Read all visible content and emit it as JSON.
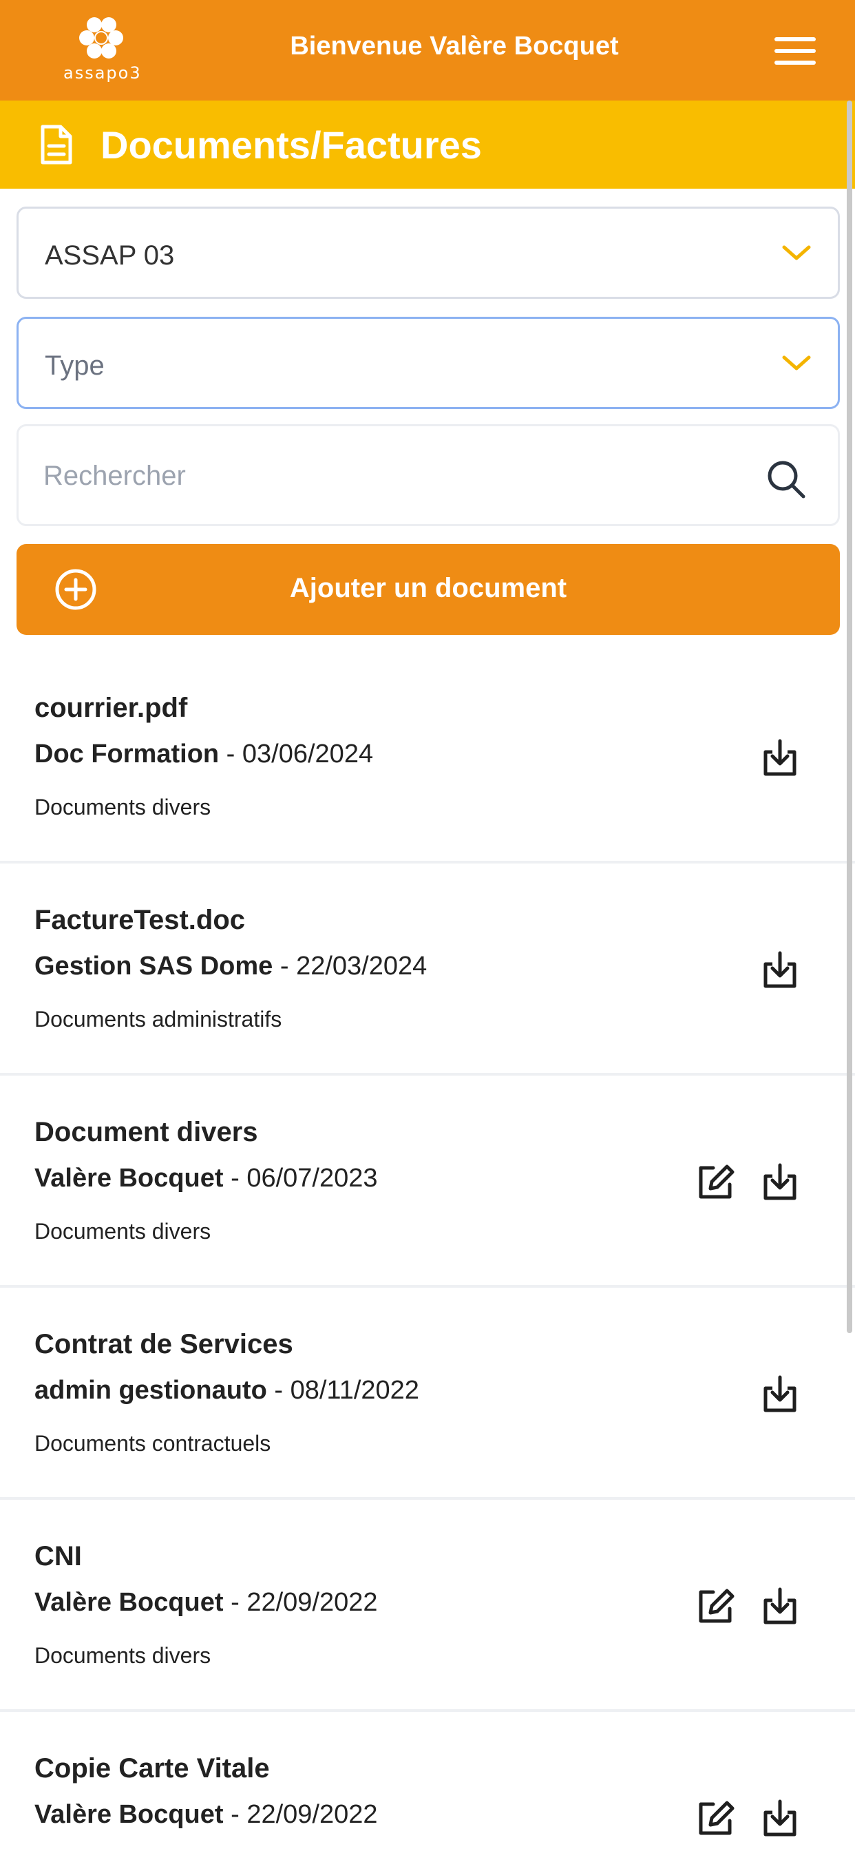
{
  "header": {
    "logo_text": "assapo3",
    "welcome": "Bienvenue Valère Bocquet",
    "menu_icon": "hamburger-menu-icon"
  },
  "page": {
    "title": "Documents/Factures",
    "title_icon": "document-icon"
  },
  "filters": {
    "structure_value": "ASSAP 03",
    "type_placeholder": "Type",
    "search_placeholder": "Rechercher",
    "add_button_label": "Ajouter un document"
  },
  "colors": {
    "header_orange": "#ef8c14",
    "title_yellow": "#f9bd00",
    "chevron_yellow": "#f4b400"
  },
  "documents": [
    {
      "name": "courrier.pdf",
      "author": "Doc Formation",
      "date": " - 03/06/2024",
      "category": "Documents divers",
      "editable": false
    },
    {
      "name": "FactureTest.doc",
      "author": "Gestion SAS Dome",
      "date": " - 22/03/2024",
      "category": "Documents administratifs",
      "editable": false
    },
    {
      "name": "Document divers",
      "author": "Valère Bocquet",
      "date": " - 06/07/2023",
      "category": "Documents divers",
      "editable": true
    },
    {
      "name": "Contrat de Services",
      "author": "admin gestionauto",
      "date": " - 08/11/2022",
      "category": "Documents contractuels",
      "editable": false
    },
    {
      "name": "CNI",
      "author": "Valère Bocquet",
      "date": " - 22/09/2022",
      "category": "Documents divers",
      "editable": true
    },
    {
      "name": "Copie Carte Vitale",
      "author": "Valère Bocquet",
      "date": " - 22/09/2022",
      "category": "",
      "editable": true
    }
  ]
}
